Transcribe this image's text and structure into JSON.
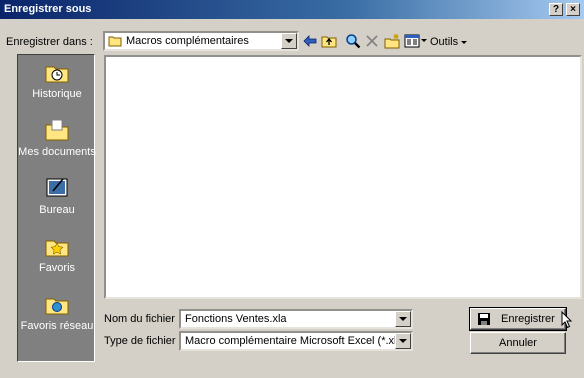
{
  "window": {
    "title": "Enregistrer sous",
    "help_btn": "?",
    "close_btn": "×"
  },
  "toolbar": {
    "save_in_label": "Enregistrer dans :",
    "current_folder": "Macros complémentaires",
    "tools_label": "Outils"
  },
  "places": [
    {
      "label": "Historique",
      "icon": "history-icon"
    },
    {
      "label": "Mes documents",
      "icon": "my-documents-icon"
    },
    {
      "label": "Bureau",
      "icon": "desktop-icon"
    },
    {
      "label": "Favoris",
      "icon": "favorites-icon"
    },
    {
      "label": "Favoris réseau",
      "icon": "network-places-icon"
    }
  ],
  "form": {
    "filename_label": "Nom du fichier :",
    "filename_value": "Fonctions Ventes.xla",
    "filetype_label": "Type de fichier :",
    "filetype_value": "Macro complémentaire Microsoft Excel (*.xla)"
  },
  "buttons": {
    "save": "Enregistrer",
    "cancel": "Annuler"
  }
}
